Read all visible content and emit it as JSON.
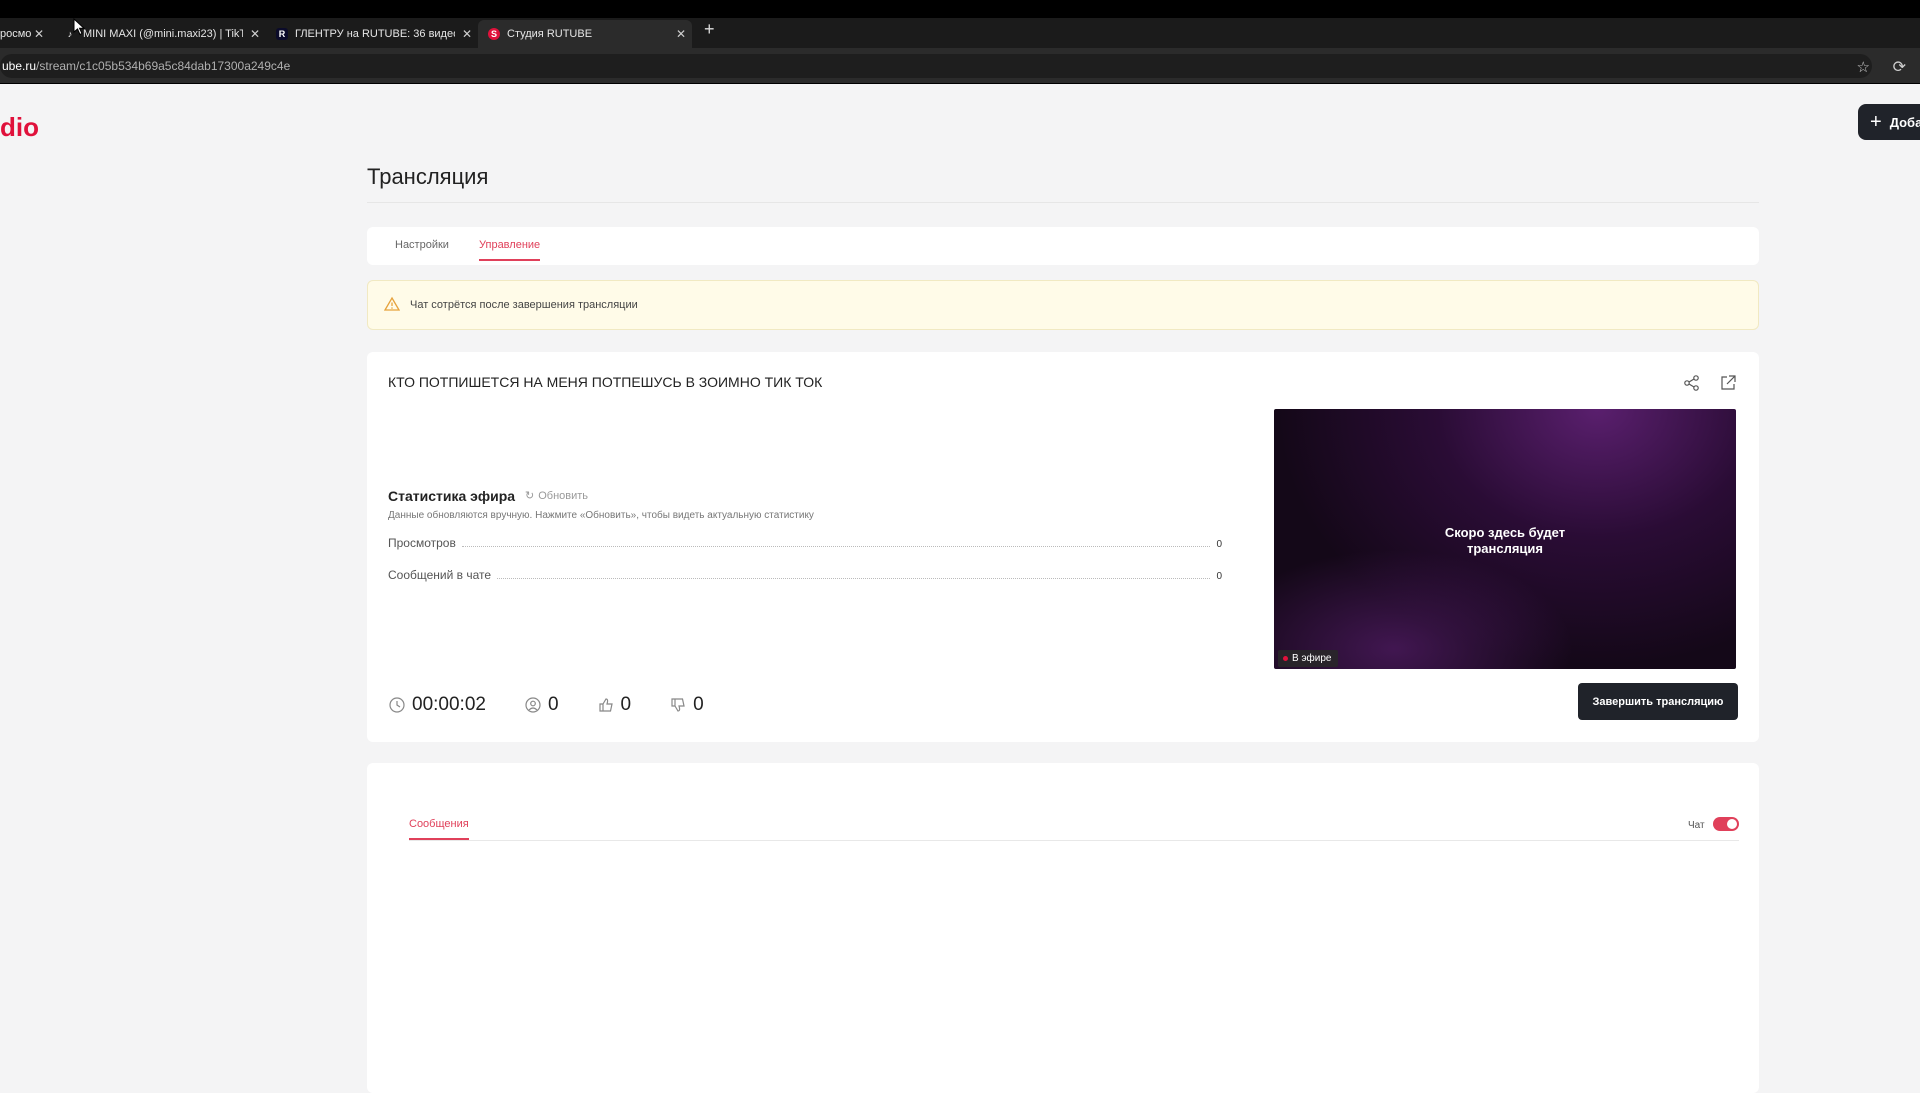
{
  "browser": {
    "tabs": [
      {
        "title": "росмо",
        "favicon": ""
      },
      {
        "title": "MINI MAXI (@mini.maxi23) | TikT",
        "favicon": "tiktok-icon"
      },
      {
        "title": "ГЛЕНТРУ на RUTUBE: 36 видео -",
        "favicon": "rutube-icon"
      },
      {
        "title": "Студия RUTUBE",
        "favicon": "rutube-studio-icon"
      }
    ],
    "url_domain": "ube.ru",
    "url_path": "/stream/c1c05b534b69a5c84dab17300a249c4e"
  },
  "app": {
    "logo": "dio",
    "add_button": "Доба"
  },
  "page": {
    "title": "Трансляция",
    "tabs": [
      {
        "label": "Настройки",
        "active": false
      },
      {
        "label": "Управление",
        "active": true
      }
    ],
    "warning": "Чат сотрётся после завершения трансляции"
  },
  "stream": {
    "title": "КТО ПОТПИШЕТСЯ НА МЕНЯ ПОТПЕШУСЬ В ЗОИМНО ТИК ТОК",
    "stats_heading": "Статистика эфира",
    "refresh": "Обновить",
    "stats_note": "Данные обновляются вручную. Нажмите «Обновить», чтобы видеть актуальную статистику",
    "stats": [
      {
        "label": "Просмотров",
        "value": "0"
      },
      {
        "label": "Сообщений в чате",
        "value": "0"
      }
    ],
    "duration": "00:00:02",
    "viewers": "0",
    "likes": "0",
    "dislikes": "0",
    "player_text_1": "Скоро здесь будет",
    "player_text_2": "трансляция",
    "live_badge": "В эфире",
    "end_button": "Завершить трансляцию"
  },
  "chat": {
    "tab": "Сообщения",
    "toggle_label": "Чат",
    "toggle_on": true
  },
  "colors": {
    "accent": "#e0405a",
    "brand": "#e0113b",
    "dark_button": "#20232a"
  }
}
